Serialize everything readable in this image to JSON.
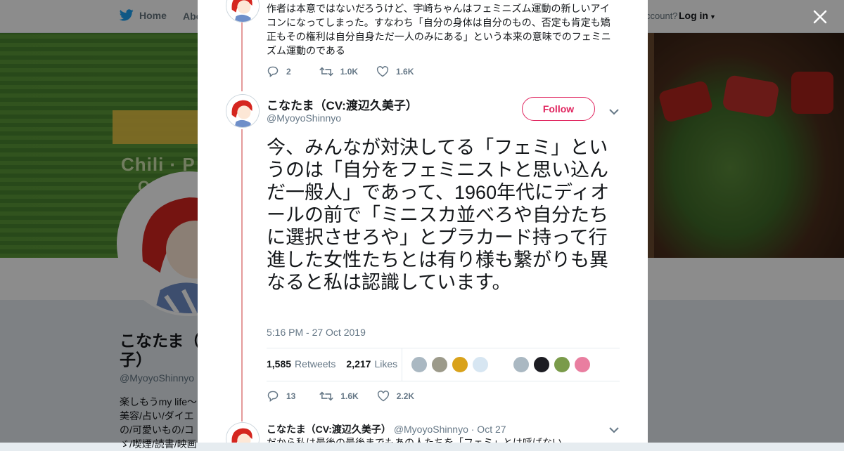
{
  "nav": {
    "home_label": "Home",
    "about_label": "Abo",
    "account_text": "ccount?",
    "login_label": "Log in"
  },
  "profile": {
    "name": "こなたま（(\n子）",
    "handle": "@MyoyoShinnyo",
    "bio": "楽しもうmy life〜\n美容/占い/ダイエ\nの/可愛いもの/コ\nゞ/喫煙/読書/映画"
  },
  "modal": {
    "prev_tweet": {
      "text": "作者は本意ではないだろうけど、宇崎ちゃんはフェミニズム運動の新しいアイコンになってしまった。すなわち「自分の身体は自分のもの、否定も肯定も矯正もその権利は自分自身ただ一人のみにある」という本来の意味でのフェミニズム運動のである",
      "replies": "2",
      "retweets": "1.0K",
      "likes": "1.6K"
    },
    "main_tweet": {
      "name": "こなたま（CV:渡辺久美子）",
      "handle": "@MyoyoShinnyo",
      "follow_label": "Follow",
      "text": "今、みんなが対決してる「フェミ」というのは「自分をフェミニストと思い込んだ一般人」であって、1960年代にディオールの前で「ミニスカ並べろや自分たちに選択させろや」とプラカード持って行進した女性たちとは有り様も繋がりも異なると私は認識しています。",
      "timestamp": "5:16 PM - 27 Oct 2019",
      "retweet_count": "1,585",
      "retweet_label": "Retweets",
      "like_count": "2,217",
      "like_label": "Likes",
      "replies": "13",
      "retweets": "1.6K",
      "likes": "2.2K"
    },
    "next_tweet": {
      "name": "こなたま（CV:渡辺久美子）",
      "handle": "@MyoyoShinnyo",
      "date": "· Oct 27",
      "text": "だから私は最後の最後までもあの人たちを「フェミ」とは呼ばない"
    }
  },
  "colors": {
    "accent": "#e0245e",
    "thread_line": "#e49a9a",
    "twitter_blue": "#1da1f2",
    "muted": "#657786"
  },
  "icons": [
    "twitter-bird-icon",
    "close-icon",
    "reply-icon",
    "retweet-icon",
    "like-icon",
    "chevron-down-icon"
  ]
}
